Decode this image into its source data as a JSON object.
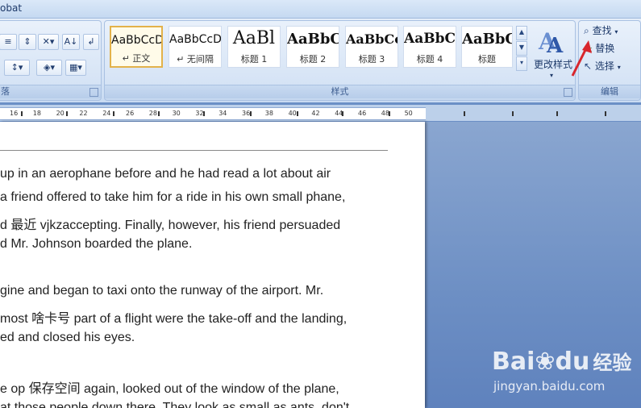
{
  "titlebar": {
    "title": "obat"
  },
  "ribbon": {
    "paragraph_group_label": "落",
    "styles_group_label": "样式",
    "edit_group_label": "编辑",
    "styles": [
      {
        "preview": "AaBbCcD",
        "name": "↵ 正文",
        "selected": true
      },
      {
        "preview": "AaBbCcD",
        "name": "↵ 无间隔"
      },
      {
        "preview": "AaBl",
        "name": "标题 1"
      },
      {
        "preview": "AaBbC",
        "name": "标题 2"
      },
      {
        "preview": "AaBbCc",
        "name": "标题 3"
      },
      {
        "preview": "AaBbC",
        "name": "标题 4"
      },
      {
        "preview": "AaBbC",
        "name": "标题"
      }
    ],
    "change_styles_label": "更改样式",
    "edit": {
      "find": "查找",
      "replace": "替换",
      "select": "选择"
    }
  },
  "ruler": {
    "numbers": [
      "16",
      "18",
      "20",
      "22",
      "24",
      "26",
      "28",
      "30",
      "32",
      "34",
      "36",
      "38",
      "40",
      "42",
      "44",
      "46",
      "48",
      "50"
    ]
  },
  "document": {
    "lines": [
      "up in an aerophane before and he had read a lot about air",
      "a friend offered to take him for a ride in his own small phane,",
      "d 最近 vjkzaccepting. Finally, however, his friend persuaded",
      "d Mr. Johnson boarded the plane.",
      "",
      "gine and began to taxi onto the runway of the airport. Mr.",
      "most 啥卡号 part of a flight were the take-off and the landing,",
      "ed and closed his eyes.",
      "",
      "e op 保存空间 again, looked out of the window of the plane,",
      "at those people down there. They look as small as ants, don't"
    ]
  },
  "watermark": {
    "brand": "Bai",
    "brand2": "du",
    "brand_cn": "经验",
    "url": "jingyan.baidu.com"
  },
  "colors": {
    "accent": "#e3b24a",
    "arrow": "#d8262c",
    "workspace": "#6d8fc4"
  }
}
